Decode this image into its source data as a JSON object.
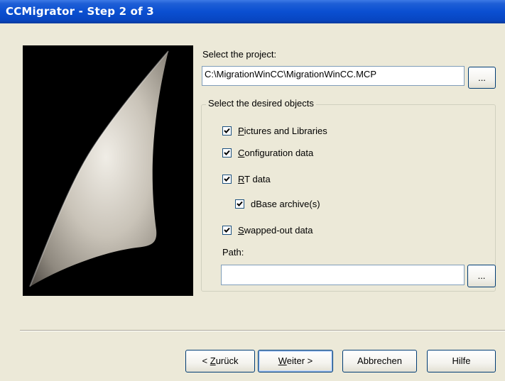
{
  "window": {
    "title": "CCMigrator - Step 2 of 3"
  },
  "project": {
    "label": "Select the project:",
    "path_value": "C:\\MigrationWinCC\\MigrationWinCC.MCP",
    "browse_label": "..."
  },
  "objects": {
    "group_title": "Select the desired objects",
    "items": [
      {
        "label_first": "P",
        "label_rest": "ictures and Libraries",
        "checked": true
      },
      {
        "label_first": "C",
        "label_rest": "onfiguration data",
        "checked": true
      },
      {
        "label_first": "R",
        "label_rest": "T data",
        "checked": true
      },
      {
        "label_first": "",
        "label_rest": "dBase archive(s)",
        "checked": true
      },
      {
        "label_first": "S",
        "label_rest": "wapped-out data",
        "checked": true
      }
    ],
    "path_label": "Path:",
    "path_value": "",
    "path_browse_label": "..."
  },
  "buttons": {
    "back_prefix": "< ",
    "back_u": "Z",
    "back_rest": "urück",
    "next_u": "W",
    "next_rest": "eiter >",
    "cancel": "Abbrechen",
    "help": "Hilfe"
  }
}
